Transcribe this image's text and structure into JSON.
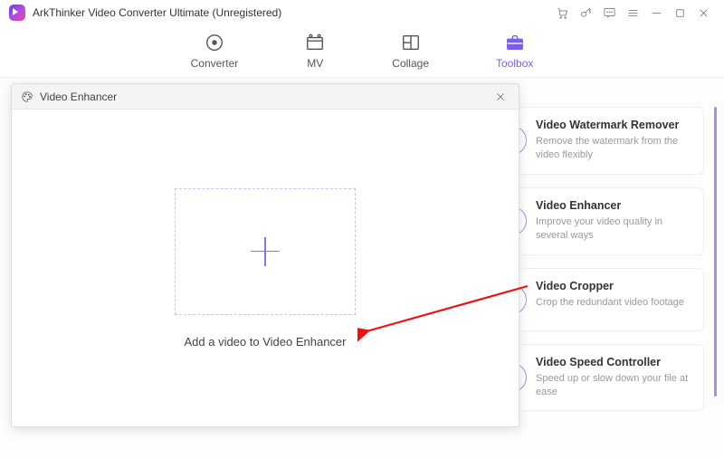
{
  "app": {
    "title": "ArkThinker Video Converter Ultimate (Unregistered)"
  },
  "tabs": {
    "converter": "Converter",
    "mv": "MV",
    "collage": "Collage",
    "toolbox": "Toolbox"
  },
  "modal": {
    "title": "Video Enhancer",
    "drop_caption": "Add a video to Video Enhancer"
  },
  "cards": {
    "watermark": {
      "title": "Video Watermark Remover",
      "desc": "Remove the watermark from the video flexibly"
    },
    "enhancer": {
      "title": "Video Enhancer",
      "desc": "Improve your video quality in several ways"
    },
    "cropper": {
      "title": "Video Cropper",
      "desc": "Crop the redundant video footage"
    },
    "speed": {
      "title": "Video Speed Controller",
      "desc": "Speed up or slow down your file at ease"
    }
  }
}
